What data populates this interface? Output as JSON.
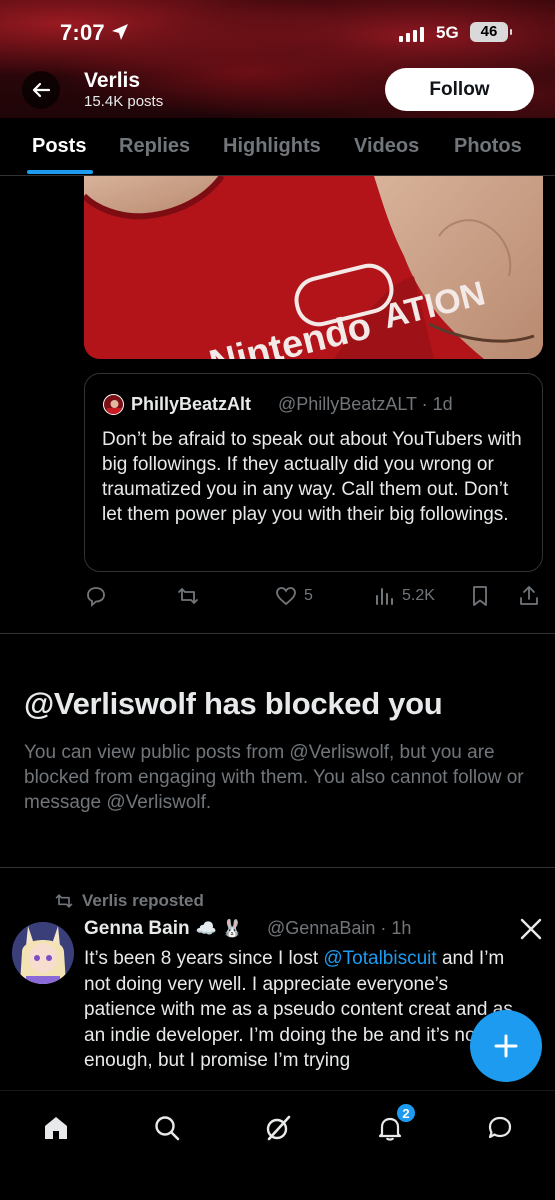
{
  "status_bar": {
    "time": "7:07",
    "network": "5G",
    "battery": "46"
  },
  "header": {
    "name": "Verlis",
    "posts_count": "15.4K posts",
    "follow_label": "Follow"
  },
  "tabs": [
    {
      "label": "Posts",
      "active": true
    },
    {
      "label": "Replies",
      "active": false
    },
    {
      "label": "Highlights",
      "active": false
    },
    {
      "label": "Videos",
      "active": false
    },
    {
      "label": "Photos",
      "active": false
    }
  ],
  "tweet_image": {
    "shirt_text": "Nintendo",
    "shirt_text_2": "ATION"
  },
  "quoted_tweet": {
    "name": "PhillyBeatzAlt",
    "handle_time": "@PhillyBeatzALT · 1d",
    "text": "Don’t be afraid to speak out about YouTubers with big followings. If they actually did you wrong or traumatized you in any way. Call them out. Don’t let them power play you with their big followings."
  },
  "actions": {
    "likes": "5",
    "views": "5.2K"
  },
  "blocked": {
    "title": "@Verliswolf has blocked you",
    "text": "You can view public posts from @Verliswolf, but you are blocked from engaging with them. You also cannot follow or message @Verliswolf."
  },
  "repost": {
    "label": "Verlis reposted",
    "name": "Genna Bain",
    "name_emoji": "☁️ 🐰",
    "handle_time": "@GennaBain · 1h",
    "text_before": "It’s been 8 years since I lost ",
    "mention": "@Totalbiscuit",
    "text_after": " and I’m not doing very well. I appreciate everyone’s patience with me as a pseudo content creat and as an indie developer. I’m doing the be and it’s not enough, but I promise I’m trying"
  },
  "bottom_nav": {
    "notification_count": "2",
    "icons": [
      "home-icon",
      "search-icon",
      "grok-icon",
      "bell-icon",
      "messages-icon"
    ]
  },
  "colors": {
    "accent": "#1d9bf0",
    "muted": "#71767b",
    "text": "#e7e9ea",
    "shirt": "#b9161b"
  }
}
